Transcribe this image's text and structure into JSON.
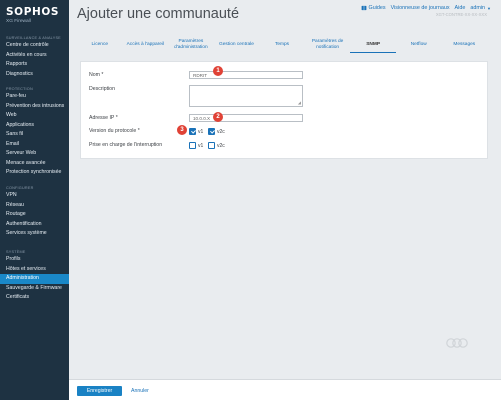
{
  "brand": {
    "name": "SOPHOS",
    "product": "XG Firewall"
  },
  "sidebar": {
    "sections": [
      {
        "heading": "SURVEILLANCE & ANALYSE",
        "items": [
          "Centre de contrôle",
          "Activités en cours",
          "Rapports",
          "Diagnostics"
        ]
      },
      {
        "heading": "PROTECTION",
        "items": [
          "Pare-feu",
          "Prévention des intrusions",
          "Web",
          "Applications",
          "Sans fil",
          "Email",
          "Serveur Web",
          "Menace avancée",
          "Protection synchronisée"
        ]
      },
      {
        "heading": "CONFIGURER",
        "items": [
          "VPN",
          "Réseau",
          "Routage",
          "Authentification",
          "Services système"
        ]
      },
      {
        "heading": "SYSTÈME",
        "items": [
          "Profils",
          "Hôtes et services",
          "Administration",
          "Sauvegarde & Firmware",
          "Certificats"
        ]
      }
    ],
    "active_item": "Administration"
  },
  "header": {
    "title": "Ajouter une communauté",
    "links": {
      "guides": "Guides",
      "log_viewer": "Visionneuse de journaux",
      "help": "Aide",
      "user": "admin"
    },
    "device_info": "XGT-CONTRE-XX-XX-XXX"
  },
  "tabs": [
    {
      "label": "Licence"
    },
    {
      "label": "Accès à l'appareil"
    },
    {
      "label": "Paramètres d'administration"
    },
    {
      "label": "Gestion centrale"
    },
    {
      "label": "Temps"
    },
    {
      "label": "Paramètres de notification"
    },
    {
      "label": "SNMP",
      "active": true
    },
    {
      "label": "Netflow"
    },
    {
      "label": "Messages"
    }
  ],
  "form": {
    "name_label": "Nom *",
    "name_value": "RDRIT",
    "description_label": "Description",
    "description_value": "",
    "ip_label": "Adresse IP *",
    "ip_value": "10.0.0.X",
    "protocol_label": "Version du protocole *",
    "protocol_options": [
      {
        "label": "v1",
        "checked": true
      },
      {
        "label": "v2c",
        "checked": true
      }
    ],
    "trap_label": "Prise en charge de l'interruption",
    "trap_options": [
      {
        "label": "v1",
        "checked": false
      },
      {
        "label": "v2c",
        "checked": false
      }
    ]
  },
  "steps": [
    "1",
    "2",
    "3",
    "4"
  ],
  "footer": {
    "save_label": "Enregistrer",
    "cancel_label": "Annuler"
  },
  "colors": {
    "sidebar_bg": "#1e3242",
    "accent": "#1a82c4",
    "active_nav": "#1a88c8",
    "badge": "#e04236"
  }
}
